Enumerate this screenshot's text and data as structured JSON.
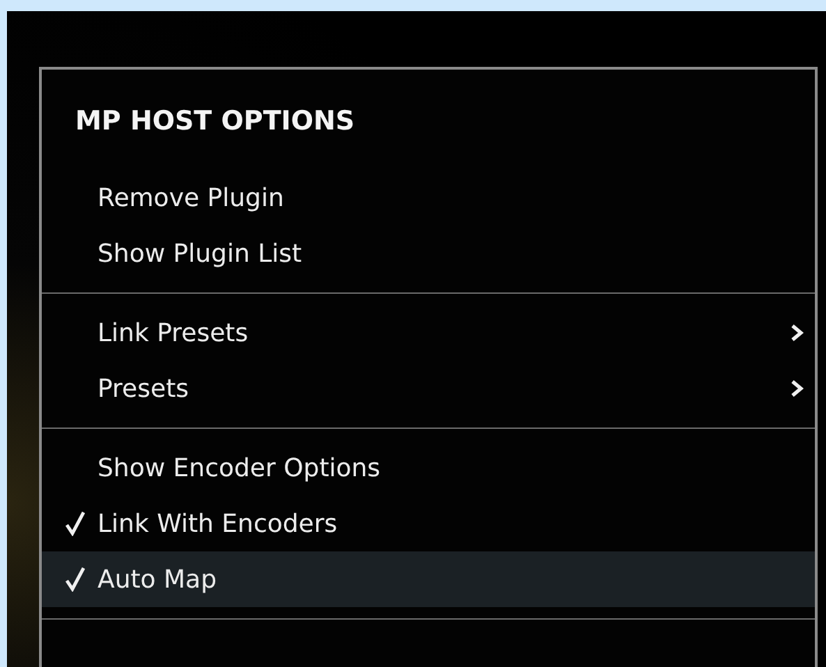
{
  "menu": {
    "title": "MP HOST OPTIONS",
    "sections": [
      {
        "items": [
          {
            "label": "Remove Plugin",
            "kind": "action",
            "checked": false,
            "selected": false
          },
          {
            "label": "Show Plugin List",
            "kind": "action",
            "checked": false,
            "selected": false
          }
        ]
      },
      {
        "items": [
          {
            "label": "Link Presets",
            "kind": "submenu",
            "checked": false,
            "selected": false
          },
          {
            "label": "Presets",
            "kind": "submenu",
            "checked": false,
            "selected": false
          }
        ]
      },
      {
        "items": [
          {
            "label": "Show Encoder Options",
            "kind": "action",
            "checked": false,
            "selected": false
          },
          {
            "label": "Link With Encoders",
            "kind": "action",
            "checked": true,
            "selected": false
          },
          {
            "label": "Auto Map",
            "kind": "action",
            "checked": true,
            "selected": true
          }
        ]
      }
    ]
  }
}
